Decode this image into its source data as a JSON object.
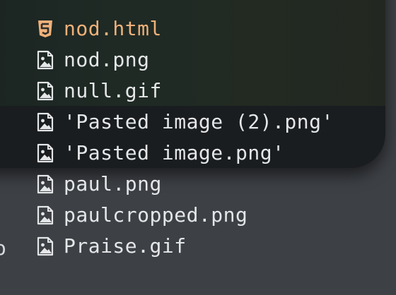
{
  "files": [
    {
      "name": "nod.html",
      "type": "html",
      "icon": "html5-icon"
    },
    {
      "name": "nod.png",
      "type": "image",
      "icon": "image-file-icon"
    },
    {
      "name": "null.gif",
      "type": "image",
      "icon": "image-file-icon"
    },
    {
      "name": "'Pasted image (2).png'",
      "type": "image",
      "icon": "image-file-icon"
    },
    {
      "name": "'Pasted image.png'",
      "type": "image",
      "icon": "image-file-icon"
    },
    {
      "name": "paul.png",
      "type": "image",
      "icon": "image-file-icon"
    },
    {
      "name": "paulcropped.png",
      "type": "image",
      "icon": "image-file-icon"
    },
    {
      "name": "Praise.gif",
      "type": "image",
      "icon": "image-file-icon"
    }
  ],
  "edge_text": "o",
  "colors": {
    "text": "#e4e6e8",
    "html_accent": "#f0b17a",
    "background": "#3d4045",
    "terminal": "#1f2a25"
  }
}
